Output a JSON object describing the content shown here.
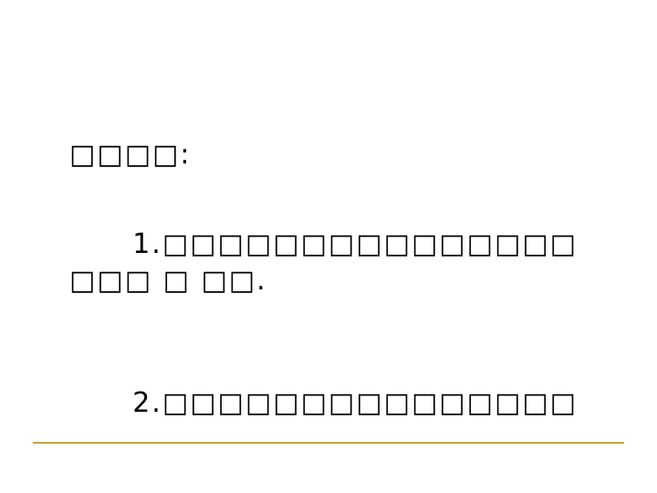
{
  "slide": {
    "heading": "□□□□:",
    "items": [
      {
        "number": "1.",
        "text": "□□□□□□□□□□□□□□□□□□ □ □□."
      },
      {
        "number": "2.",
        "text": "□□□□□□□□□□□□□□□"
      }
    ]
  },
  "colors": {
    "accent_rule": "#c8a63a",
    "text": "#000000",
    "background": "#ffffff"
  }
}
